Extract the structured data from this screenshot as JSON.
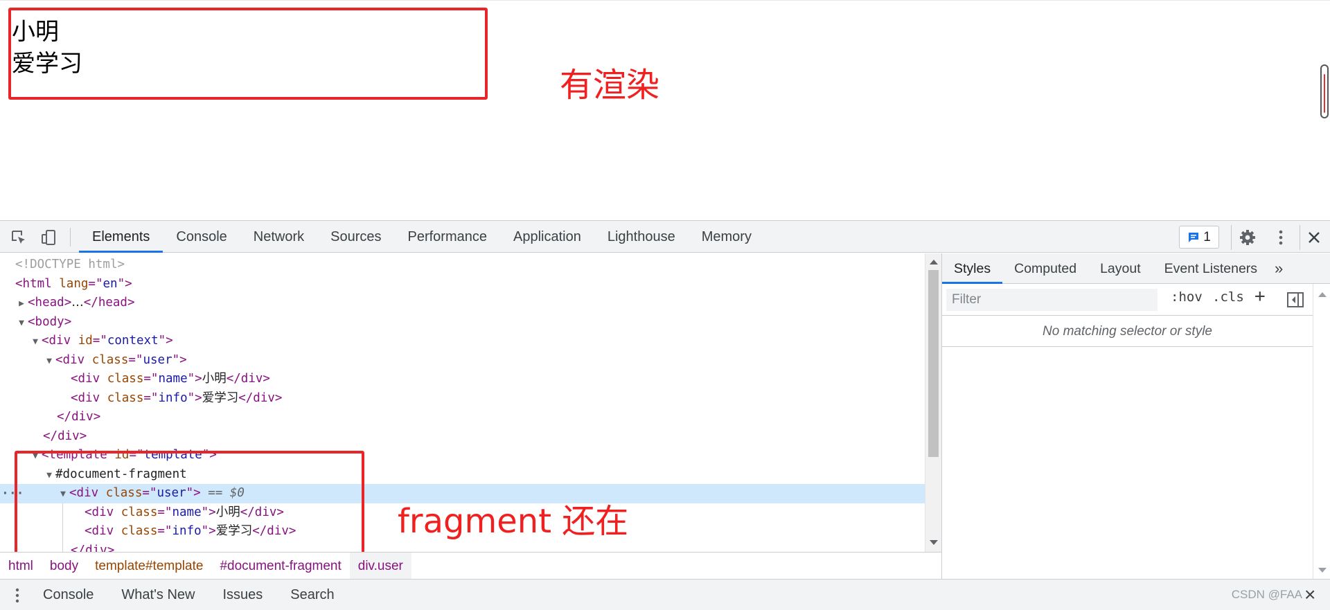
{
  "page": {
    "name_text": "小明",
    "info_text": "爱学习",
    "annotation_rendered": "有渲染",
    "annotation_fragment": "fragment 还在"
  },
  "colors": {
    "annotation_red": "#f02020",
    "accent_blue": "#1a73e8",
    "selected_row": "#cfe8fc"
  },
  "devtools": {
    "tabs": [
      "Elements",
      "Console",
      "Network",
      "Sources",
      "Performance",
      "Application",
      "Lighthouse",
      "Memory"
    ],
    "active_tab": "Elements",
    "issues_count": "1",
    "icons": {
      "inspect": "inspect-element-icon",
      "device": "device-toolbar-icon",
      "issues": "message-icon",
      "settings": "gear-icon",
      "more": "vertical-ellipsis-icon",
      "close": "close-icon"
    }
  },
  "dom": {
    "doctype": "<!DOCTYPE html>",
    "html_tag": "html",
    "lang_attr": "lang",
    "lang_val": "en",
    "head_tag": "head",
    "body_tag": "body",
    "div_tag": "div",
    "id_attr": "id",
    "class_attr": "class",
    "context_val": "context",
    "user_val": "user",
    "name_val": "name",
    "info_val": "info",
    "name_text": "小明",
    "info_text": "爱学习",
    "template_tag": "template",
    "template_val": "template",
    "fragment": "#document-fragment",
    "eq_ref": "== $0",
    "ellipsis": "…",
    "row_ellipsis": "···"
  },
  "breadcrumbs": [
    "html",
    "body",
    "template#template",
    "#document-fragment",
    "div.user"
  ],
  "styles_pane": {
    "tabs": [
      "Styles",
      "Computed",
      "Layout",
      "Event Listeners"
    ],
    "overflow": "»",
    "active_tab": "Styles",
    "filter_placeholder": "Filter",
    "hov": ":hov",
    "cls": ".cls",
    "plus": "+",
    "no_match": "No matching selector or style"
  },
  "drawer": {
    "tabs": [
      "Console",
      "What's New",
      "Issues",
      "Search"
    ],
    "close": "×"
  },
  "watermark": "CSDN @FAA"
}
